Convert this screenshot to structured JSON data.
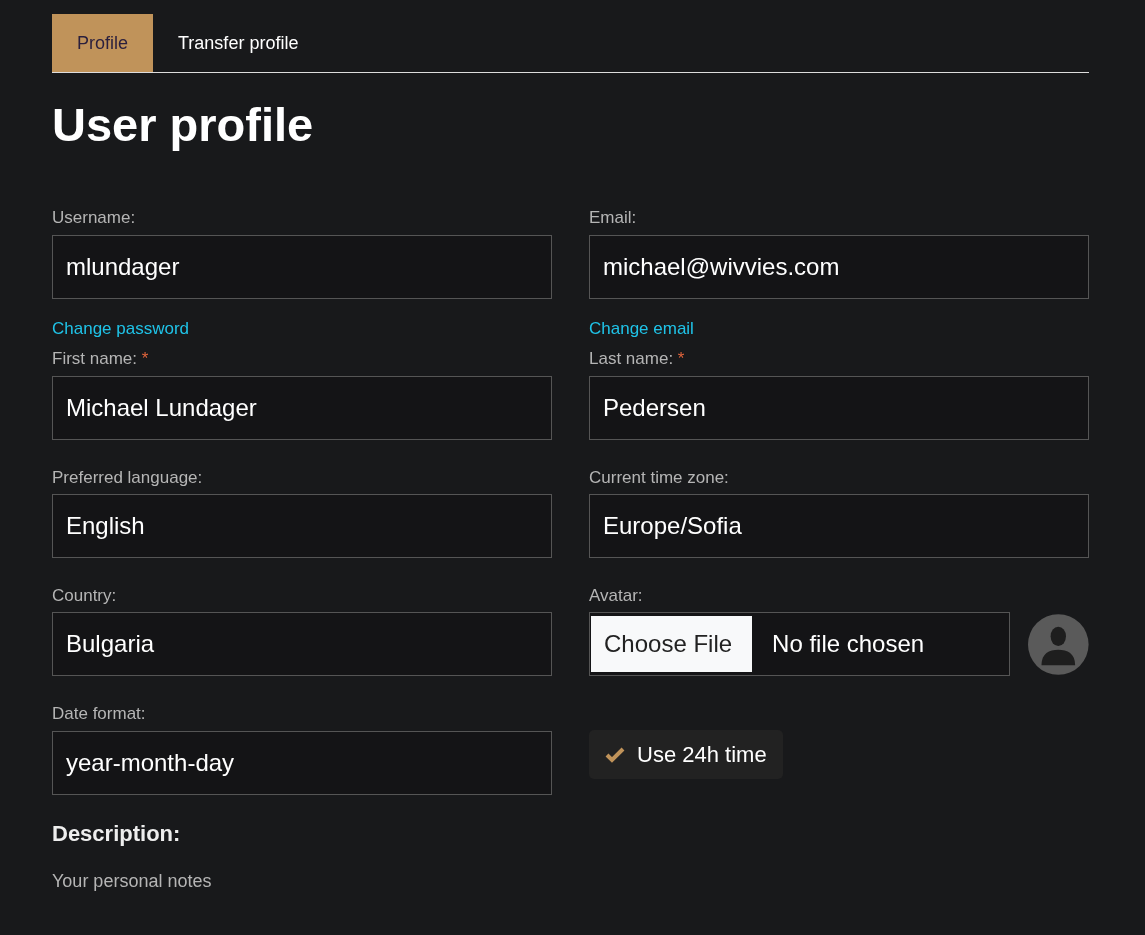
{
  "tabs": [
    {
      "label": "Profile",
      "selected": true
    },
    {
      "label": "Transfer profile",
      "selected": false
    }
  ],
  "title": "User profile",
  "fields": [
    {
      "kind": "text",
      "label": "Username:",
      "value": "mlundager",
      "link": "Change password"
    },
    {
      "kind": "text",
      "label": "Email:",
      "value": "michael@wivvies.com",
      "link": "Change email"
    },
    {
      "kind": "text",
      "label": "First name:",
      "mark": "*",
      "value": "Michael Lundager"
    },
    {
      "kind": "text",
      "label": "Last name:",
      "mark": "*",
      "value": "Pedersen"
    },
    {
      "kind": "text",
      "label": "Preferred language:",
      "value": "English"
    },
    {
      "kind": "text",
      "label": "Current time zone:",
      "value": "Europe/Sofia"
    },
    {
      "kind": "text",
      "label": "Country:",
      "value": "Bulgaria"
    },
    {
      "kind": "file",
      "label": "Avatar:",
      "button": "Choose File",
      "value": "No file chosen"
    },
    {
      "kind": "text",
      "label": "Date format:",
      "value": "year-month-day"
    },
    {
      "kind": "checkbox",
      "label": "Use 24h time",
      "checked": true
    }
  ],
  "description": {
    "heading": "Description:",
    "placeholder": "Your personal notes"
  }
}
